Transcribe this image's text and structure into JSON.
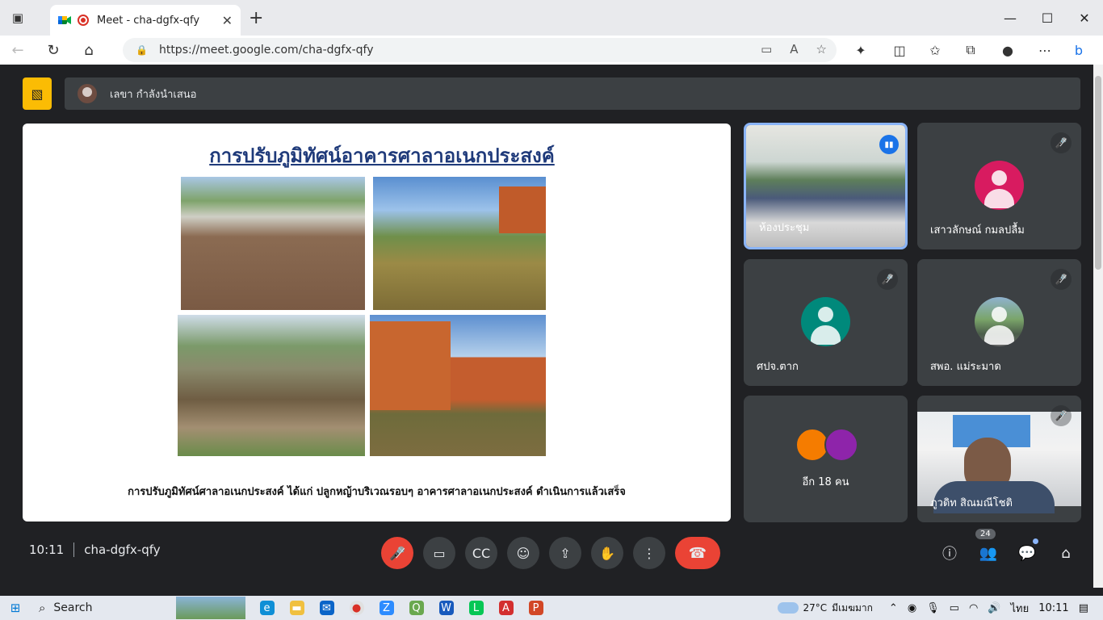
{
  "browser": {
    "tab_title": "Meet - cha-dgfx-qfy",
    "url": "https://meet.google.com/cha-dgfx-qfy"
  },
  "presentation": {
    "presenter_label": "เลขา กำลังนำเสนอ",
    "slide_title": "การปรับภูมิทัศน์อาคารศาลาอเนกประสงค์",
    "slide_caption": "การปรับภูมิทัศน์ศาลาอเนกประสงค์ ได้แก่ ปลูกหญ้าบริเวณรอบๆ อาคารศาลาอเนกประสงค์ ดำเนินการแล้วเสร็จ"
  },
  "participants": [
    {
      "name": "ห้องประชุม"
    },
    {
      "name": "เสาวลักษณ์ กมลปลื้ม",
      "avatar_color": "#d81b60"
    },
    {
      "name": "ศปจ.ตาก",
      "avatar_color": "#00897b"
    },
    {
      "name": "สพอ. แม่ระมาด"
    },
    {
      "more_label": "อีก 18 คน"
    },
    {
      "name": "ภูวดิท สิณมณีโชติ"
    }
  ],
  "bottom_bar": {
    "time": "10:11",
    "meeting_code": "cha-dgfx-qfy",
    "people_count": "24"
  },
  "taskbar": {
    "search_label": "Search",
    "temperature": "27°C",
    "weather_text": "มีเมฆมาก",
    "language": "ไทย",
    "clock": "10:11"
  },
  "colors": {
    "accent_blue": "#1a73e8",
    "hangup_red": "#ea4335",
    "present_yellow": "#fbbc04"
  }
}
